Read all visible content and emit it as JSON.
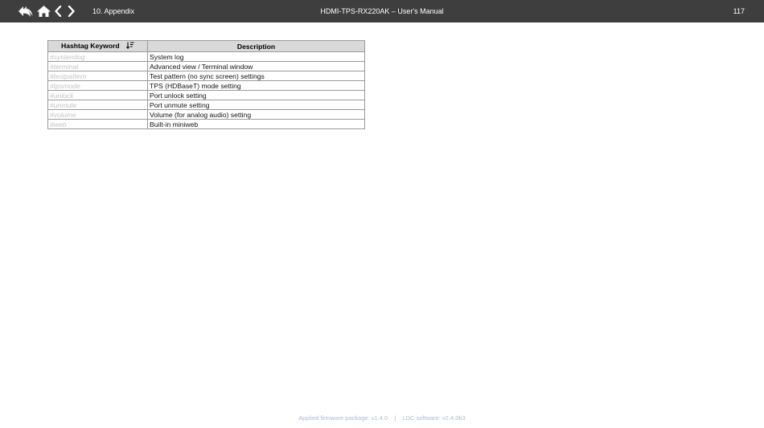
{
  "header": {
    "chapter": "10. Appendix",
    "doc_title": "HDMI-TPS-RX220AK – User's Manual",
    "page_number": "117",
    "icons": [
      "back-icon",
      "home-icon",
      "previous-page-icon",
      "next-page-icon"
    ]
  },
  "table": {
    "col_keyword": "Hashtag Keyword",
    "col_description": "Description",
    "rows": [
      {
        "keyword": "#systemlog",
        "description": "System log"
      },
      {
        "keyword": "#terminal",
        "description": "Advanced view / Terminal window"
      },
      {
        "keyword": "#testpattern",
        "description": "Test pattern (no sync screen) settings"
      },
      {
        "keyword": "#tpsmode",
        "description": "TPS (HDBaseT) mode setting"
      },
      {
        "keyword": "#unlock",
        "description": "Port unlock setting"
      },
      {
        "keyword": "#unmute",
        "description": "Port unmute setting"
      },
      {
        "keyword": "#volume",
        "description": "Volume (for analog audio) setting"
      },
      {
        "keyword": "#web",
        "description": "Built-in miniweb"
      }
    ]
  },
  "footer": {
    "firmware": "Applied firmware package: v1.4.0",
    "separator": "|",
    "ldc": "LDC software: v2.4.0b3"
  },
  "colors": {
    "topbar": "#3e3e3e",
    "table_header": "#d9d9d9",
    "keyword_text": "#c4c4c4",
    "footer_text": "#a9bcd6"
  }
}
